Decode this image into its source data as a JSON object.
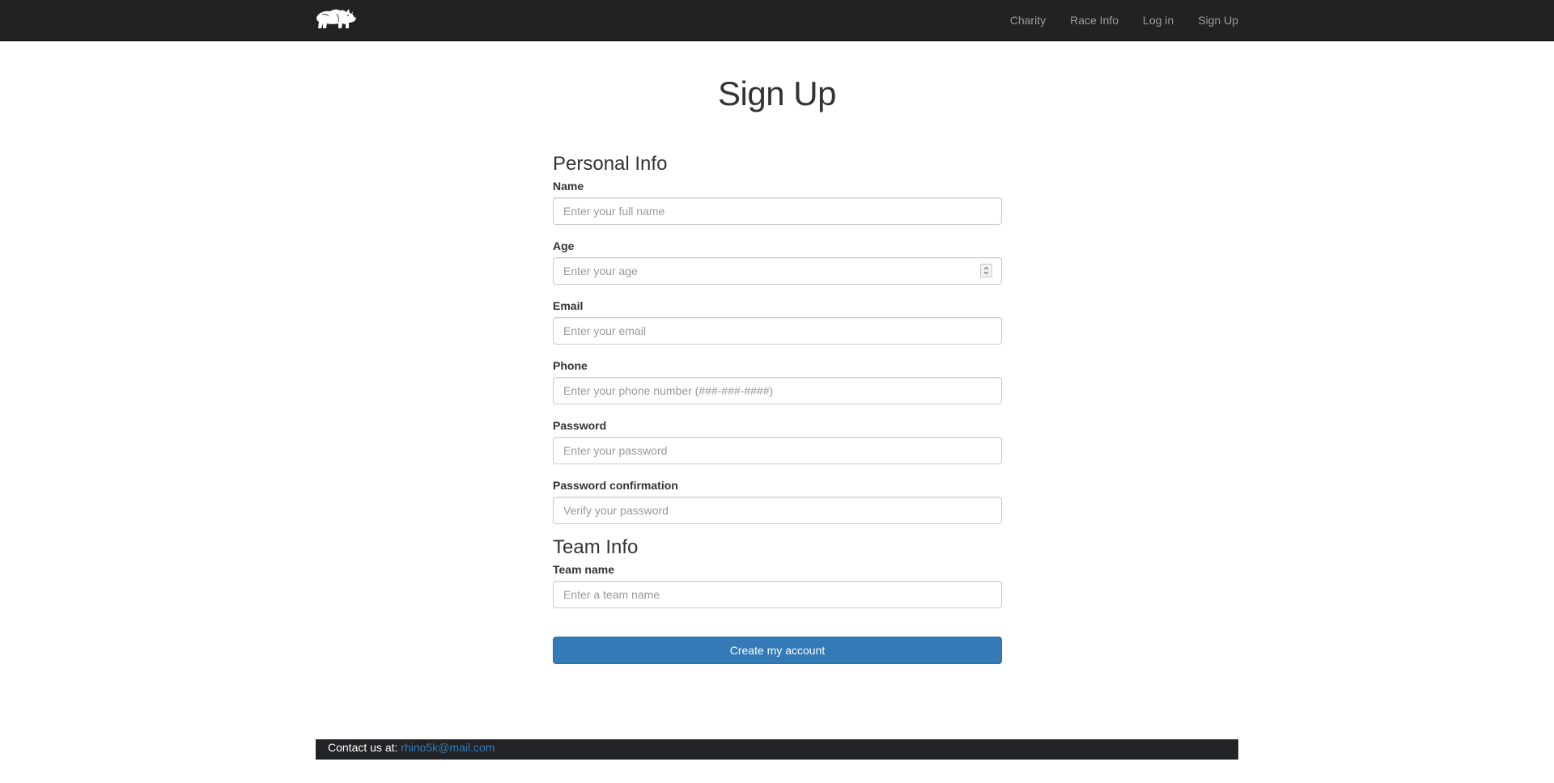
{
  "navbar": {
    "brand_icon": "rhino-logo-icon",
    "links": [
      "Charity",
      "Race Info",
      "Log in",
      "Sign Up"
    ]
  },
  "page": {
    "title": "Sign Up"
  },
  "form": {
    "personal_heading": "Personal Info",
    "fields": {
      "name": {
        "label": "Name",
        "placeholder": "Enter your full name"
      },
      "age": {
        "label": "Age",
        "placeholder": "Enter your age"
      },
      "email": {
        "label": "Email",
        "placeholder": "Enter your email"
      },
      "phone": {
        "label": "Phone",
        "placeholder": "Enter your phone number (###-###-####)"
      },
      "password": {
        "label": "Password",
        "placeholder": "Enter your password"
      },
      "password_confirmation": {
        "label": "Password confirmation",
        "placeholder": "Verify your password"
      },
      "team_name": {
        "label": "Team name",
        "placeholder": "Enter a team name"
      }
    },
    "team_heading": "Team Info",
    "submit_label": "Create my account"
  },
  "footer": {
    "contact_label": "Contact us at:",
    "email": "rhino5k@mail.com"
  },
  "colors": {
    "navbar_bg": "#222222",
    "nav_link": "#9d9d9d",
    "primary_button": "#337ab7",
    "footer_bg": "#222326",
    "link": "#337ab7"
  }
}
